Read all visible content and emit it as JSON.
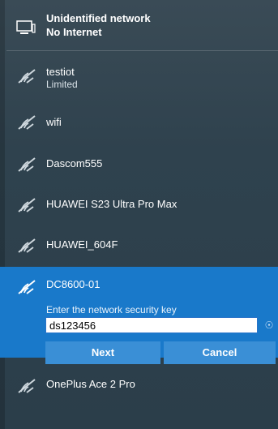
{
  "status": {
    "title": "Unidentified network",
    "subtitle": "No Internet"
  },
  "networks": [
    {
      "name": "testiot",
      "status": "Limited"
    },
    {
      "name": "wifi"
    },
    {
      "name": "Dascom555"
    },
    {
      "name": "HUAWEI S23 Ultra Pro Max"
    },
    {
      "name": "HUAWEI_604F"
    }
  ],
  "selected": {
    "name": "DC8600-01",
    "prompt": "Enter the network security key",
    "key_value": "ds123456",
    "next_label": "Next",
    "cancel_label": "Cancel"
  },
  "after": [
    {
      "name": "OnePlus Ace 2 Pro"
    }
  ],
  "colors": {
    "accent": "#1979ca",
    "panel": "#2f424e",
    "button": "#3a8fd6"
  }
}
